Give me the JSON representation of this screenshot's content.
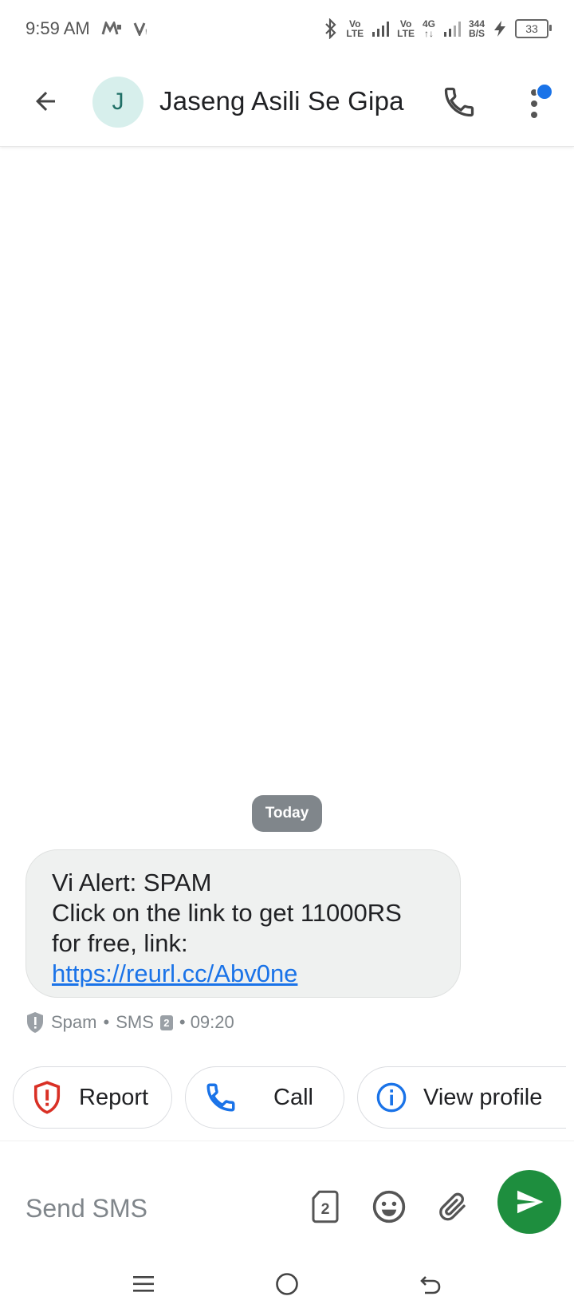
{
  "status_bar": {
    "time": "9:59 AM",
    "carrier_icons": [
      "M",
      "V"
    ],
    "volte1": "Vo\nLTE",
    "volte2": "Vo\nLTE",
    "net_type": "4G",
    "speed_value": "344",
    "speed_unit": "B/S",
    "battery": "33"
  },
  "app_bar": {
    "avatar_letter": "J",
    "contact_name": "Jaseng Asili Se Gipa"
  },
  "conversation": {
    "date_chip": "Today",
    "message": {
      "line1": "Vi Alert: SPAM",
      "line2": "Click on the link to get 11000RS",
      "line3": "for free, link:",
      "link": "https://reurl.cc/Abv0ne"
    },
    "meta": {
      "label": "Spam",
      "separator": "•",
      "type": "SMS",
      "sim": "2",
      "time": "• 09:20"
    }
  },
  "suggestions": {
    "report_label": "Report",
    "call_label": "Call",
    "profile_label": "View profile"
  },
  "compose": {
    "placeholder": "Send SMS",
    "sim_number": "2"
  },
  "colors": {
    "accent_blue": "#1a73e8",
    "send_green": "#1e8e3e",
    "report_red": "#d93025",
    "bubble_bg": "#eff1f0"
  }
}
